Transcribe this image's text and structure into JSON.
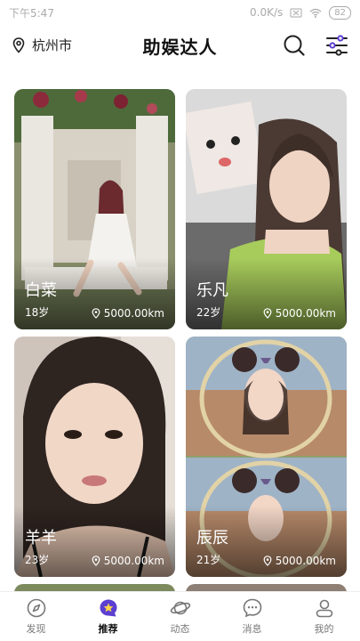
{
  "status": {
    "time": "下午5:47",
    "speed": "0.0K/s",
    "battery": "82"
  },
  "header": {
    "location": "杭州市",
    "title": "助娱达人"
  },
  "cards": [
    {
      "name": "白菜",
      "age": "18岁",
      "distance": "5000.00km"
    },
    {
      "name": "乐凡",
      "age": "22岁",
      "distance": "5000.00km"
    },
    {
      "name": "羊羊",
      "age": "23岁",
      "distance": "5000.00km"
    },
    {
      "name": "辰辰",
      "age": "21岁",
      "distance": "5000.00km"
    }
  ],
  "tabs": [
    {
      "label": "发现",
      "icon": "compass-icon"
    },
    {
      "label": "推荐",
      "icon": "star-bubble-icon",
      "active": true
    },
    {
      "label": "动态",
      "icon": "planet-icon"
    },
    {
      "label": "消息",
      "icon": "chat-icon"
    },
    {
      "label": "我的",
      "icon": "user-icon"
    }
  ],
  "colors": {
    "accent": "#5b3fd1",
    "text": "#111111",
    "muted": "#777777"
  }
}
